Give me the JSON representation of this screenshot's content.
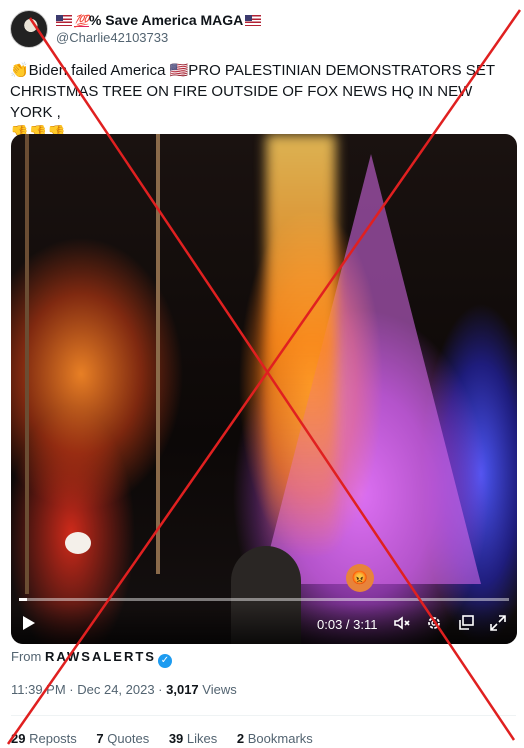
{
  "author": {
    "display_name": "% Save America MAGA",
    "hundred_emoji": "💯",
    "handle": "@Charlie42103733"
  },
  "tweet": {
    "text_line1": "👏Biden failed America 🇺🇸PRO PALESTINIAN DEMONSTRATORS SET",
    "text_line2": "CHRISTMAS TREE ON FIRE OUTSIDE OF FOX NEWS HQ IN NEW YORK ,",
    "text_line3": "👎👎👎"
  },
  "video": {
    "time": "0:03 / 3:11",
    "progress": 0.016,
    "play_icon": "play-icon",
    "volume_icon": "volume-muted-icon",
    "settings_icon": "settings-gear-icon",
    "popout_icon": "pop-out-icon",
    "fullscreen_icon": "fullscreen-icon"
  },
  "source": {
    "from_label": "From",
    "name": "RAWSALERTS"
  },
  "meta": {
    "timestamp": "11:39 PM · Dec 24, 2023 · ",
    "views_count": "3,017",
    "views_label": " Views"
  },
  "stats": {
    "reposts_count": "29",
    "reposts_label": "Reposts",
    "quotes_count": "7",
    "quotes_label": "Quotes",
    "likes_count": "39",
    "likes_label": "Likes",
    "bookmarks_count": "2",
    "bookmarks_label": "Bookmarks"
  },
  "colors": {
    "cross": "#e02020",
    "verified": "#1d9bf0",
    "muted_text": "#536471"
  }
}
